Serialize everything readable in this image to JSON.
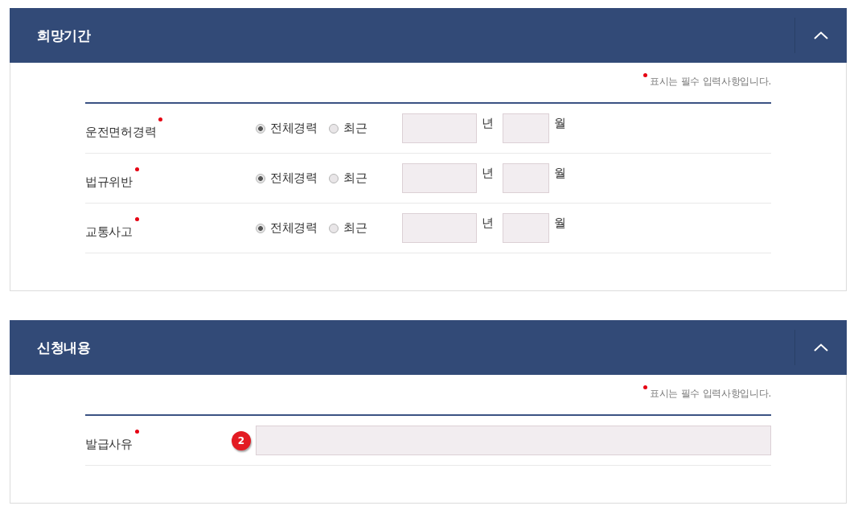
{
  "sections": [
    {
      "title": "희망기간",
      "expanded": true,
      "required_note": "표시는 필수 입력사항입니다.",
      "rows": [
        {
          "kind": "period",
          "label": "운전면허경력",
          "required": true,
          "options": [
            {
              "label": "전체경력",
              "selected": true
            },
            {
              "label": "최근",
              "selected": false
            }
          ],
          "year_unit": "년",
          "month_unit": "월"
        },
        {
          "kind": "period",
          "label": "법규위반",
          "required": true,
          "options": [
            {
              "label": "전체경력",
              "selected": true
            },
            {
              "label": "최근",
              "selected": false
            }
          ],
          "year_unit": "년",
          "month_unit": "월"
        },
        {
          "kind": "period",
          "label": "교통사고",
          "required": true,
          "options": [
            {
              "label": "전체경력",
              "selected": true
            },
            {
              "label": "최근",
              "selected": false
            }
          ],
          "year_unit": "년",
          "month_unit": "월"
        }
      ]
    },
    {
      "title": "신청내용",
      "expanded": true,
      "required_note": "표시는 필수 입력사항입니다.",
      "rows": [
        {
          "kind": "text",
          "label": "발급사유",
          "required": true,
          "marker": "2"
        }
      ]
    }
  ]
}
